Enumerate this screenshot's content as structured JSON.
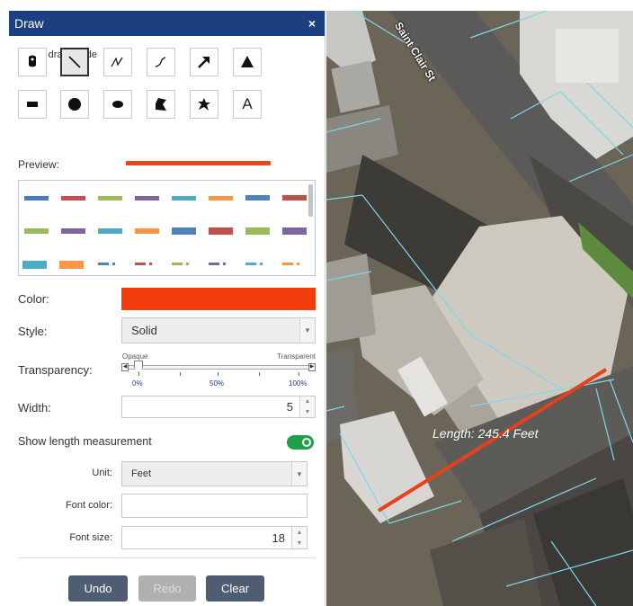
{
  "panel": {
    "title": "Draw",
    "close_glyph": "×",
    "select_mode_label": "Select draw mode",
    "tools": [
      {
        "name": "point-tool",
        "icon": "map-pin-icon",
        "selected": false
      },
      {
        "name": "line-tool",
        "icon": "line-icon",
        "selected": true
      },
      {
        "name": "polyline-tool",
        "icon": "polyline-icon",
        "selected": false
      },
      {
        "name": "freehand-line-tool",
        "icon": "freehand-line-icon",
        "selected": false
      },
      {
        "name": "arrow-tool",
        "icon": "arrow-icon",
        "selected": false
      },
      {
        "name": "triangle-tool",
        "icon": "triangle-icon",
        "selected": false
      },
      {
        "name": "rectangle-tool",
        "icon": "rectangle-icon",
        "selected": false
      },
      {
        "name": "circle-tool",
        "icon": "circle-icon",
        "selected": false
      },
      {
        "name": "ellipse-tool",
        "icon": "ellipse-icon",
        "selected": false
      },
      {
        "name": "polygon-tool",
        "icon": "polygon-icon",
        "selected": false
      },
      {
        "name": "freehand-polygon-tool",
        "icon": "freehand-polygon-icon",
        "selected": false
      },
      {
        "name": "text-tool",
        "icon": "text-icon",
        "label": "A",
        "selected": false
      }
    ],
    "preview_label": "Preview:",
    "preview_color": "#e74420",
    "color_label": "Color:",
    "color_value": "#f23d0c",
    "style_label": "Style:",
    "style_value": "Solid",
    "transparency_label": "Transparency:",
    "transparency": {
      "min_label": "Opaque",
      "max_label": "Transparent",
      "ticks": [
        "0%",
        "50%",
        "100%"
      ],
      "value_percent": 0
    },
    "width_label": "Width:",
    "width_value": "5",
    "measure_label": "Show length measurement",
    "measure_enabled": true,
    "unit_label": "Unit:",
    "unit_value": "Feet",
    "font_color_label": "Font color:",
    "font_color_value": "",
    "font_size_label": "Font size:",
    "font_size_value": "18",
    "buttons": {
      "undo": "Undo",
      "redo": "Redo",
      "clear": "Clear"
    }
  },
  "map": {
    "street_label": "Saint Clair St",
    "measurement_label": "Length: 245.4 Feet",
    "drawn_line_color": "#e8401c",
    "parcel_line_color": "#7fd6ec"
  }
}
